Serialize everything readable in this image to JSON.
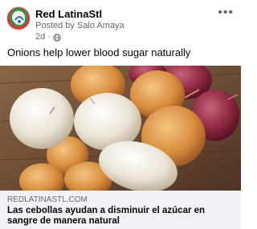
{
  "post": {
    "page_name": "Red LatinaStl",
    "posted_by": "Posted by Salo Amaya",
    "time": "2d",
    "privacy_icon": "globe-icon",
    "more_icon": "more-options-icon",
    "text": "Onions help lower blood sugar naturally"
  },
  "image": {
    "alt": "onions-photo"
  },
  "link": {
    "domain": "REDLATINASTL.COM",
    "title": "Las cebollas ayudan a disminuir el azúcar en sangre de manera natural"
  }
}
